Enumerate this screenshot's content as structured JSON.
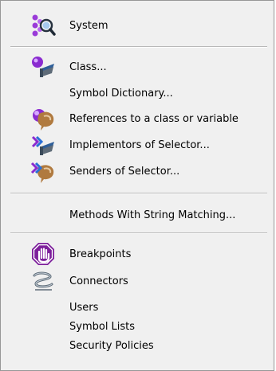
{
  "menu": {
    "items": [
      {
        "label": "System",
        "icon": "system-search-icon"
      },
      {
        "label": "Class...",
        "icon": "class-icon"
      },
      {
        "label": "Symbol Dictionary...",
        "icon": ""
      },
      {
        "label": "References to a class or variable",
        "icon": "references-icon"
      },
      {
        "label": "Implementors of Selector...",
        "icon": "implementors-icon"
      },
      {
        "label": "Senders of Selector...",
        "icon": "senders-icon"
      },
      {
        "label": "Methods With String Matching...",
        "icon": ""
      },
      {
        "label": "Breakpoints",
        "icon": "breakpoint-hand-icon"
      },
      {
        "label": "Connectors",
        "icon": "connectors-icon"
      },
      {
        "label": "Users",
        "icon": ""
      },
      {
        "label": "Symbol Lists",
        "icon": ""
      },
      {
        "label": "Security Policies",
        "icon": ""
      }
    ]
  },
  "colors": {
    "menu_background": "#f0f0f0",
    "separator": "#b7b7b7",
    "breakpoint_purple": "#7d1f9b",
    "icon_purple": "#8a2bd0",
    "icon_blue": "#2a6fd6",
    "icon_tan": "#b07a3f"
  }
}
